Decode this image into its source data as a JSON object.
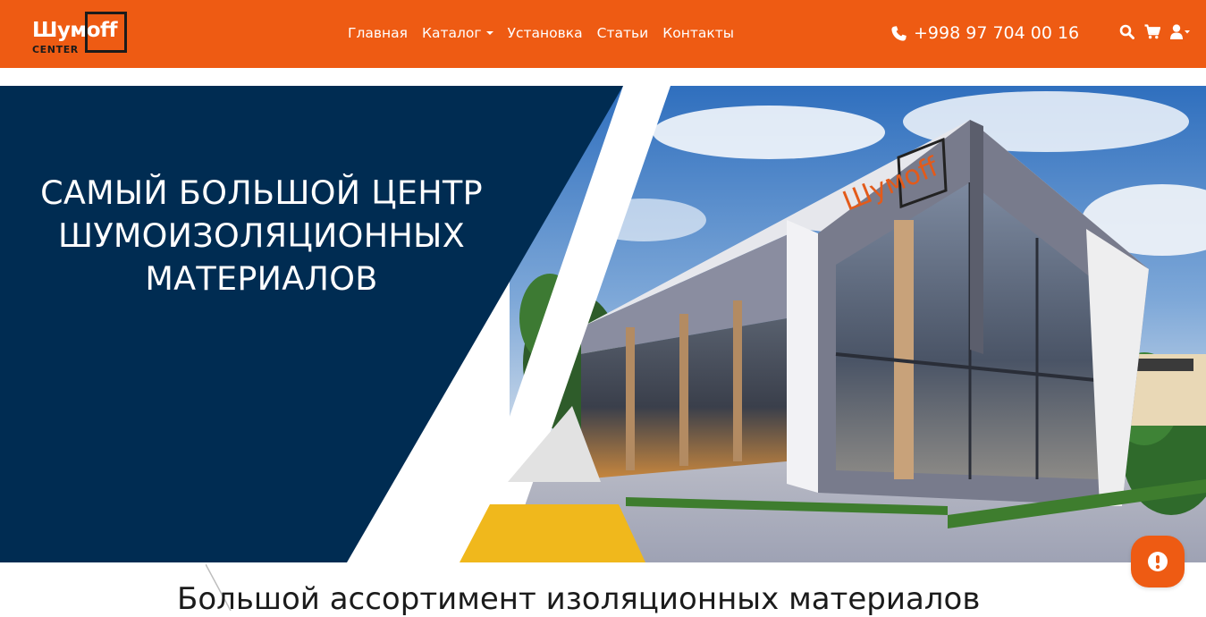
{
  "navbar": {
    "logo": {
      "main": "Шумoff",
      "sub": "CENTER"
    },
    "links": [
      {
        "label": "Главная"
      },
      {
        "label": "Каталог",
        "dropdown": true
      },
      {
        "label": "Установка"
      },
      {
        "label": "Статьи"
      },
      {
        "label": "Контакты"
      }
    ],
    "phone": "+998 97 704 00 16",
    "icons": [
      "search-icon",
      "cart-icon",
      "user-icon"
    ]
  },
  "hero": {
    "title_lines": [
      "САМЫЙ БОЛЬШОЙ ЦЕНТР",
      "ШУМОИЗОЛЯЦИОННЫХ",
      "МАТЕРИАЛОВ"
    ],
    "building_sign": "Шумoff"
  },
  "section": {
    "heading": "Большой ассортимент изоляционных материалов"
  },
  "colors": {
    "brand_orange": "#ee5b13",
    "navy": "#002c52",
    "yellow": "#f0b81c",
    "grey": "#e2e2e2"
  }
}
